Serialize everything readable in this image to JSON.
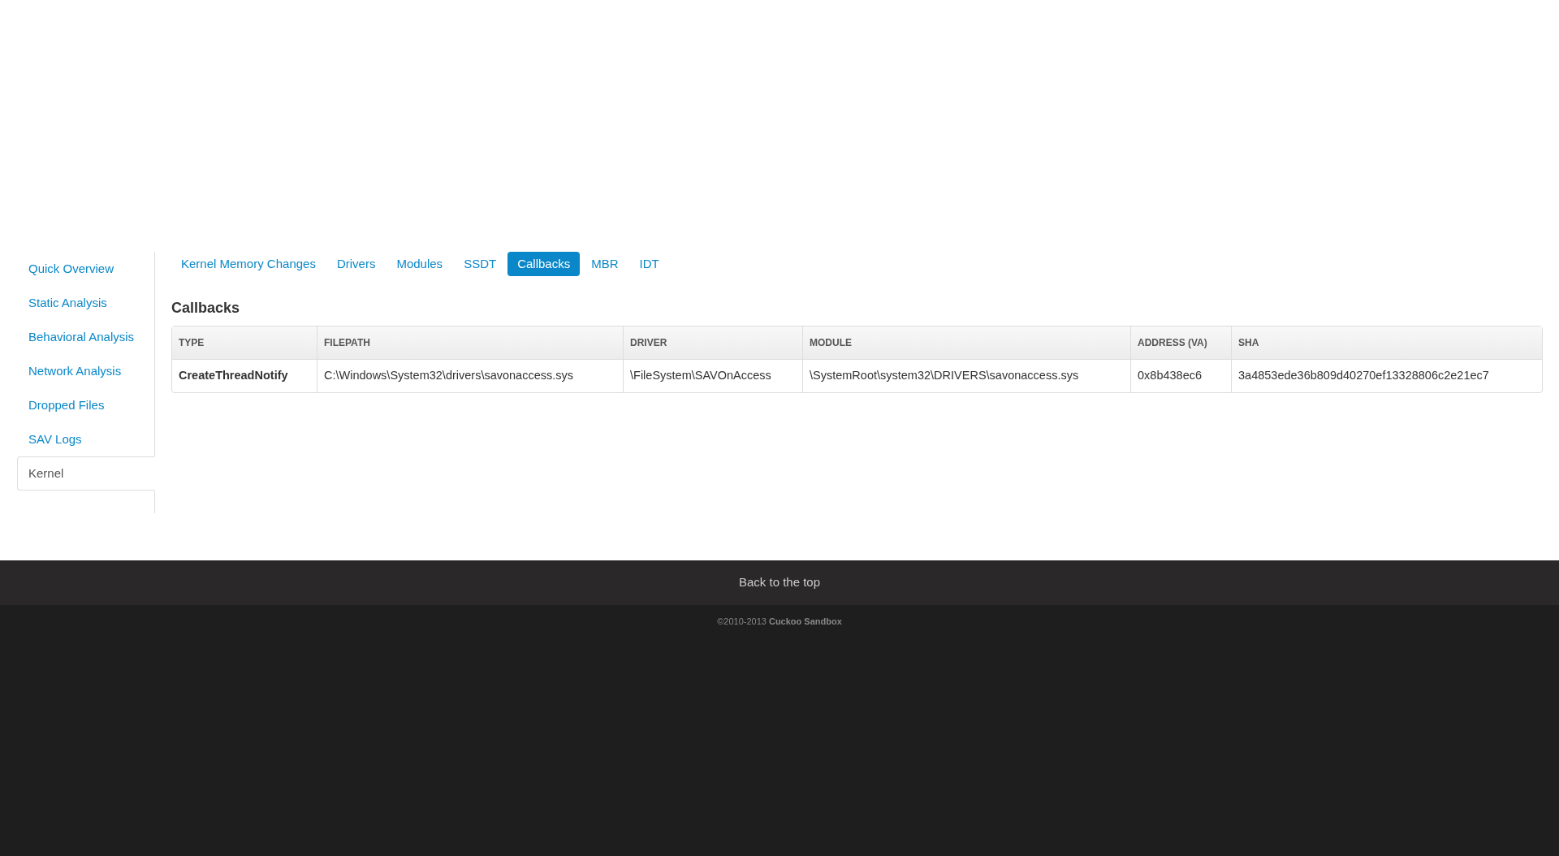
{
  "sidebar": {
    "items": [
      {
        "label": "Quick Overview",
        "selected": false
      },
      {
        "label": "Static Analysis",
        "selected": false
      },
      {
        "label": "Behavioral Analysis",
        "selected": false
      },
      {
        "label": "Network Analysis",
        "selected": false
      },
      {
        "label": "Dropped Files",
        "selected": false
      },
      {
        "label": "SAV Logs",
        "selected": false
      },
      {
        "label": "Kernel",
        "selected": true
      }
    ]
  },
  "tabs": [
    {
      "label": "Kernel Memory Changes",
      "selected": false
    },
    {
      "label": "Drivers",
      "selected": false
    },
    {
      "label": "Modules",
      "selected": false
    },
    {
      "label": "SSDT",
      "selected": false
    },
    {
      "label": "Callbacks",
      "selected": true
    },
    {
      "label": "MBR",
      "selected": false
    },
    {
      "label": "IDT",
      "selected": false
    }
  ],
  "section_title": "Callbacks",
  "table": {
    "columns": [
      "TYPE",
      "FILEPATH",
      "DRIVER",
      "MODULE",
      "ADDRESS (VA)",
      "SHA"
    ],
    "rows": [
      [
        "CreateThreadNotify",
        "C:\\Windows\\System32\\drivers\\savonaccess.sys",
        "\\FileSystem\\SAVOnAccess",
        "\\SystemRoot\\system32\\DRIVERS\\savonaccess.sys",
        "0x8b438ec6",
        "3a4853ede36b809d40270ef13328806c2e21ec7"
      ]
    ]
  },
  "footer": {
    "back_link": "Back to the top",
    "copyright": "©2010-2013 **Cuckoo Sandbox**"
  }
}
